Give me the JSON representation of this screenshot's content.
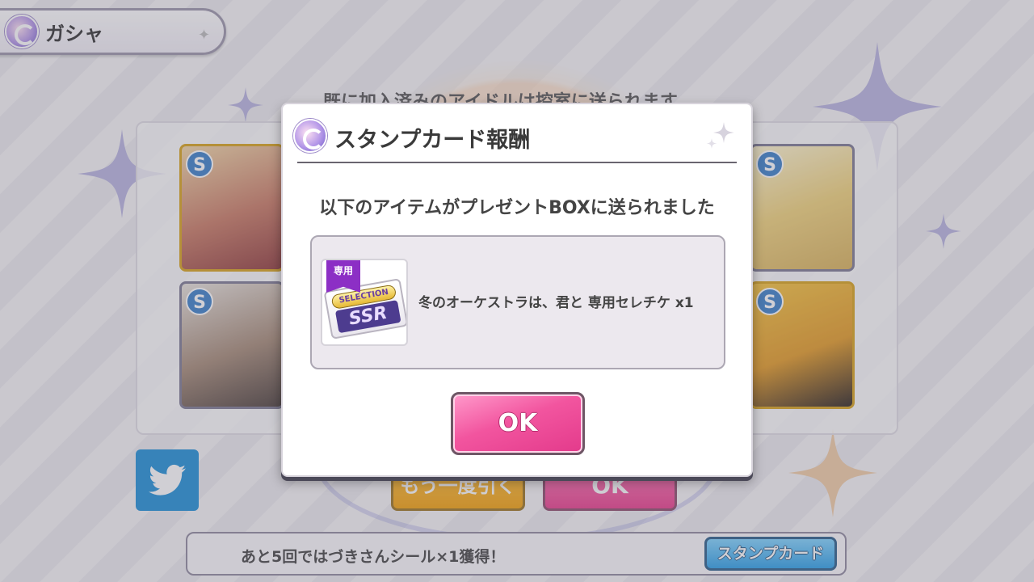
{
  "header": {
    "title": "ガシャ"
  },
  "background": {
    "result_notice": "既に加入済みのアイドルは控室に送られます",
    "retry_label": "もう一度引く",
    "ok_label": "OK",
    "stamp_bar_text": "あと5回ではづきさんシール×1獲得！",
    "stamp_card_label": "スタンプカード",
    "card_badge": "S"
  },
  "modal": {
    "title": "スタンプカード報酬",
    "message": "以下のアイテムがプレゼントBOXに送られました",
    "item": {
      "tag": "専用",
      "ticket_top": "SELECTION",
      "ticket_main": "SSR",
      "name": "冬のオーケストラは、君と 専用セレチケ x1"
    },
    "ok_label": "OK"
  },
  "colors": {
    "accent_pink": "#ea3d8c",
    "accent_orange": "#f4a10b",
    "twitter_blue": "#1e8fd8",
    "stamp_blue": "#2ca0e8"
  }
}
